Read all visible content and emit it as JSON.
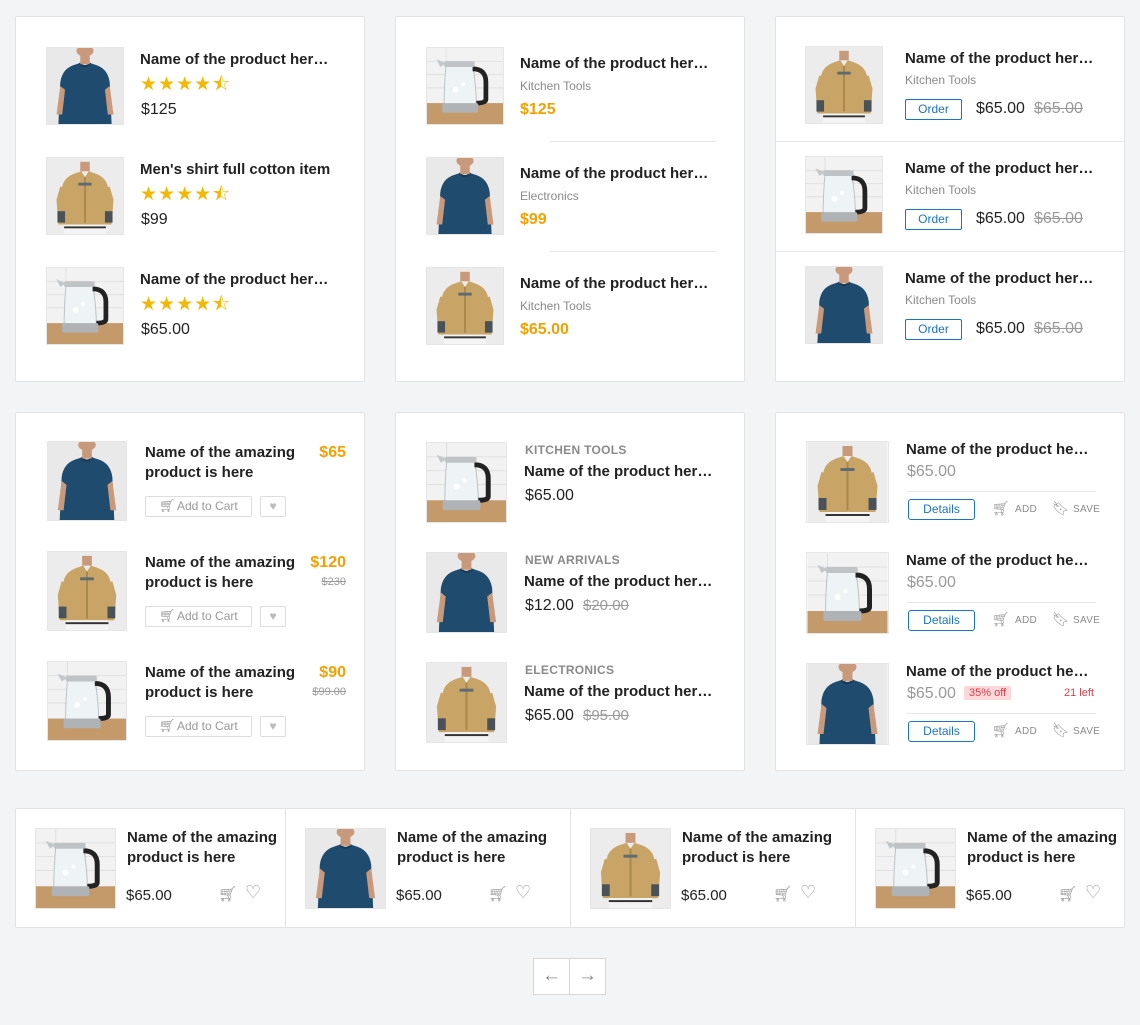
{
  "cards_row1": {
    "c1": [
      {
        "name": "Name of the product here...",
        "price": "$125",
        "image": "tshirt"
      },
      {
        "name": "Men's shirt full cotton item",
        "price": "$99",
        "image": "shirt"
      },
      {
        "name": "Name of the product here...",
        "price": "$65.00",
        "image": "kettle"
      }
    ],
    "c2": [
      {
        "name": "Name of the product here...",
        "category": "Kitchen Tools",
        "price": "$125",
        "image": "kettle"
      },
      {
        "name": "Name of the product here...",
        "category": "Electronics",
        "price": "$99",
        "image": "tshirt"
      },
      {
        "name": "Name of the product here...",
        "category": "Kitchen Tools",
        "price": "$65.00",
        "image": "shirt"
      }
    ],
    "c3": [
      {
        "name": "Name of the product here...",
        "category": "Kitchen Tools",
        "price": "$65.00",
        "old_price": "$65.00",
        "image": "shirt"
      },
      {
        "name": "Name of the product here...",
        "category": "Kitchen Tools",
        "price": "$65.00",
        "old_price": "$65.00",
        "image": "kettle"
      },
      {
        "name": "Name of the product here...",
        "category": "Kitchen Tools",
        "price": "$65.00",
        "old_price": "$65.00",
        "image": "tshirt"
      }
    ],
    "order_label": "Order",
    "rating_stars": "4.5"
  },
  "cards_row2": {
    "c1": [
      {
        "name_line1": "Name of the amazing",
        "name_line2": "product is here",
        "price": "$65",
        "old_price": "",
        "image": "tshirt"
      },
      {
        "name_line1": "Name of the amazing",
        "name_line2": "product is here",
        "price": "$120",
        "old_price": "$230",
        "image": "shirt"
      },
      {
        "name_line1": "Name of the amazing",
        "name_line2": "product is here",
        "price": "$90",
        "old_price": "$99.00",
        "image": "kettle"
      }
    ],
    "add_to_cart_label": "Add to Cart",
    "c2": [
      {
        "caption": "KITCHEN TOOLS",
        "name": "Name of the product here...",
        "price": "$65.00",
        "old_price": "",
        "image": "kettle"
      },
      {
        "caption": "NEW ARRIVALS",
        "name": "Name of the product here...",
        "price": "$12.00",
        "old_price": "$20.00",
        "image": "tshirt"
      },
      {
        "caption": "ELECTRONICS",
        "name": "Name of the product here...",
        "price": "$65.00",
        "old_price": "$95.00",
        "image": "shirt"
      }
    ],
    "c3": [
      {
        "name": "Name of the product here...",
        "price": "$65.00",
        "image": "shirt"
      },
      {
        "name": "Name of the product here...",
        "price": "$65.00",
        "image": "kettle"
      },
      {
        "name": "Name of the product here...",
        "price": "$65.00",
        "badge": "35% off",
        "stock": "21 left",
        "image": "tshirt"
      }
    ],
    "details_label": "Details",
    "add_label": "ADD",
    "save_label": "SAVE"
  },
  "carousel": [
    {
      "name_line1": "Name of the amazing",
      "name_line2": "product is here",
      "price": "$65.00",
      "image": "kettle"
    },
    {
      "name_line1": "Name of the amazing",
      "name_line2": "product is here",
      "price": "$65.00",
      "image": "tshirt"
    },
    {
      "name_line1": "Name of the amazing",
      "name_line2": "product is here",
      "price": "$65.00",
      "image": "shirt"
    },
    {
      "name_line1": "Name of the amazing",
      "name_line2": "product is here",
      "price": "$65.00",
      "image": "kettle"
    }
  ],
  "pagination": {
    "prev_icon": "arrow-left-icon",
    "next_icon": "arrow-right-icon"
  },
  "colors": {
    "accent_orange": "#f5a000",
    "accent_blue": "#1a73c8",
    "star": "#f5b800",
    "sale_red": "#e23b47"
  }
}
